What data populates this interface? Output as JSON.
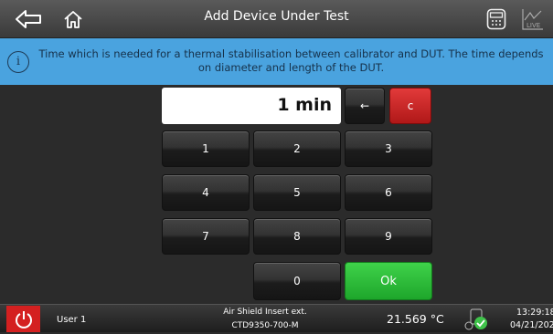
{
  "header": {
    "title": "Add Device Under Test"
  },
  "info": {
    "message": "Time which is needed for a thermal stabilisation between calibrator and DUT. The time depends on diameter and length of the DUT."
  },
  "display": {
    "value": "1 min"
  },
  "keypad": {
    "backspace": "←",
    "clear": "c",
    "k1": "1",
    "k2": "2",
    "k3": "3",
    "k4": "4",
    "k5": "5",
    "k6": "6",
    "k7": "7",
    "k8": "8",
    "k9": "9",
    "k0": "0",
    "ok": "Ok"
  },
  "status": {
    "user": "User 1",
    "device_line1": "Air Shield Insert ext.",
    "device_line2": "CTD9350-700-M",
    "temperature": "21.569 °C",
    "time": "13:29:18",
    "date": "04/21/202"
  },
  "icons": {
    "back": "back-arrow-icon",
    "home": "home-icon",
    "calculator": "calculator-icon",
    "live": "live-chart-icon",
    "info": "info-icon",
    "power": "power-icon",
    "ok_status": "check-status-icon"
  },
  "colors": {
    "info_bar": "#4aa3df",
    "clear": "#c81e1e",
    "ok": "#22b030",
    "power": "#d42020"
  },
  "icon_labels": {
    "live": "LIVE"
  }
}
